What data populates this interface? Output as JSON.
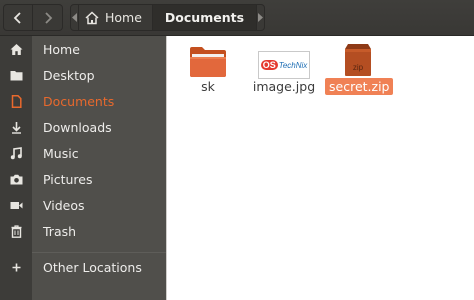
{
  "header": {
    "back_icon": "chevron-left-icon",
    "forward_icon": "chevron-right-icon",
    "breadcrumbs": [
      {
        "label": "Home",
        "icon": "home-icon"
      },
      {
        "label": "Documents"
      }
    ]
  },
  "sidebar": {
    "accent": "#e8692d",
    "items": [
      {
        "label": "Home",
        "icon": "home-icon"
      },
      {
        "label": "Desktop",
        "icon": "folder-icon"
      },
      {
        "label": "Documents",
        "icon": "document-icon",
        "active": true
      },
      {
        "label": "Downloads",
        "icon": "download-icon"
      },
      {
        "label": "Music",
        "icon": "music-icon"
      },
      {
        "label": "Pictures",
        "icon": "camera-icon"
      },
      {
        "label": "Videos",
        "icon": "video-icon"
      },
      {
        "label": "Trash",
        "icon": "trash-icon"
      },
      {
        "label": "Other Locations",
        "icon": "plus-icon"
      }
    ]
  },
  "files": [
    {
      "name": "sk",
      "type": "folder"
    },
    {
      "name": "image.jpg",
      "type": "image",
      "thumb_text_1": "OS",
      "thumb_text_2": "TechNix"
    },
    {
      "name": "secret.zip",
      "type": "archive",
      "thumb_text": "zip",
      "selected": true
    }
  ],
  "colors": {
    "selection": "#f08155",
    "folder": "#e2683c",
    "archive": "#b44e22"
  }
}
